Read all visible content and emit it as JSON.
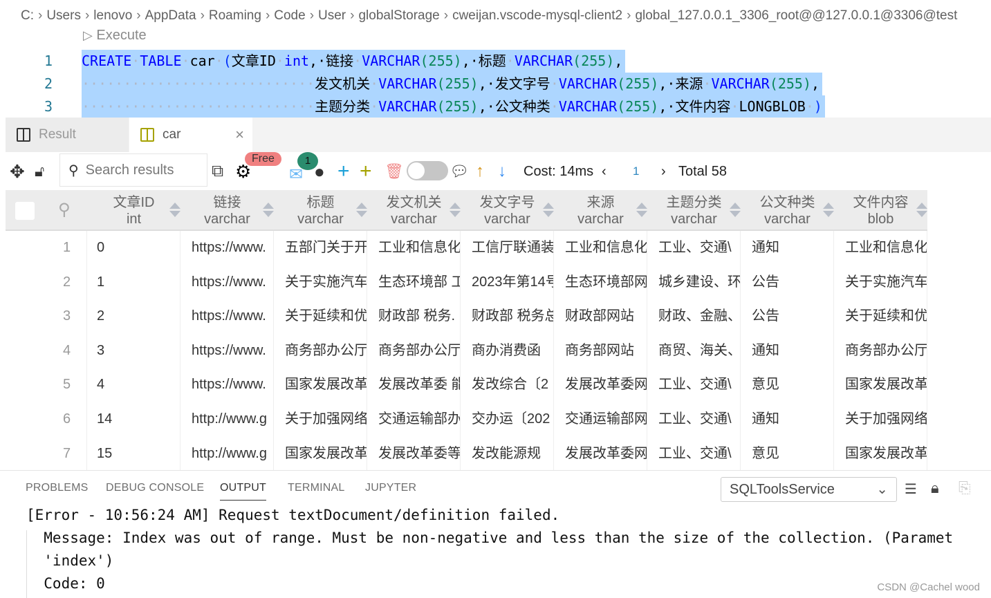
{
  "breadcrumb": [
    "C:",
    "Users",
    "lenovo",
    "AppData",
    "Roaming",
    "Code",
    "User",
    "globalStorage",
    "cweijan.vscode-mysql-client2",
    "global_127.0.0.1_3306_root@@127.0.0.1@3306@test"
  ],
  "editor": {
    "execute_label": "Execute",
    "lines": [
      {
        "num": "1",
        "tokens": [
          [
            "CREATE",
            "kw"
          ],
          [
            "·",
            "ws"
          ],
          [
            "TABLE",
            "kw"
          ],
          [
            "·",
            "ws"
          ],
          [
            "car",
            "tx"
          ],
          [
            "·",
            "ws"
          ],
          [
            "(",
            "br"
          ],
          [
            "文章ID",
            "tx"
          ],
          [
            "·",
            "ws"
          ],
          [
            "int",
            "kw"
          ],
          [
            ",·",
            "tx"
          ],
          [
            "链接",
            "tx"
          ],
          [
            "·",
            "ws"
          ],
          [
            "VARCHAR",
            "kw"
          ],
          [
            "(",
            "num"
          ],
          [
            "255",
            "num"
          ],
          [
            ")",
            "num"
          ],
          [
            ",·",
            "tx"
          ],
          [
            "标题",
            "tx"
          ],
          [
            "·",
            "ws"
          ],
          [
            "VARCHAR",
            "kw"
          ],
          [
            "(",
            "num"
          ],
          [
            "255",
            "num"
          ],
          [
            ")",
            "num"
          ],
          [
            ",",
            "tx"
          ]
        ]
      },
      {
        "num": "2",
        "tokens": [
          [
            "····························",
            "ws"
          ],
          [
            "发文机关",
            "tx"
          ],
          [
            "·",
            "ws"
          ],
          [
            "VARCHAR",
            "kw"
          ],
          [
            "(255)",
            "num"
          ],
          [
            ",·",
            "tx"
          ],
          [
            "发文字号",
            "tx"
          ],
          [
            "·",
            "ws"
          ],
          [
            "VARCHAR",
            "kw"
          ],
          [
            "(255)",
            "num"
          ],
          [
            ",·",
            "tx"
          ],
          [
            "来源",
            "tx"
          ],
          [
            "·",
            "ws"
          ],
          [
            "VARCHAR",
            "kw"
          ],
          [
            "(255)",
            "num"
          ],
          [
            ",",
            "tx"
          ]
        ]
      },
      {
        "num": "3",
        "tokens": [
          [
            "····························",
            "ws"
          ],
          [
            "主题分类",
            "tx"
          ],
          [
            "·",
            "ws"
          ],
          [
            "VARCHAR",
            "kw"
          ],
          [
            "(255)",
            "num"
          ],
          [
            ",·",
            "tx"
          ],
          [
            "公文种类",
            "tx"
          ],
          [
            "·",
            "ws"
          ],
          [
            "VARCHAR",
            "kw"
          ],
          [
            "(255)",
            "num"
          ],
          [
            ",·",
            "tx"
          ],
          [
            "文件内容",
            "tx"
          ],
          [
            "·",
            "ws"
          ],
          [
            "LONGBLOB",
            "tx"
          ],
          [
            "·",
            "ws"
          ],
          [
            ")",
            "br"
          ]
        ]
      }
    ]
  },
  "tabs": [
    {
      "label": "Result",
      "active": false
    },
    {
      "label": "car",
      "active": true
    }
  ],
  "toolbar": {
    "search_placeholder": "Search results",
    "free_badge": "Free",
    "notification_count": "1",
    "cost": "Cost: 14ms",
    "page": "1",
    "total": "Total 58"
  },
  "table": {
    "columns": [
      {
        "name": "文章ID",
        "type": "int"
      },
      {
        "name": "链接",
        "type": "varchar"
      },
      {
        "name": "标题",
        "type": "varchar"
      },
      {
        "name": "发文机关",
        "type": "varchar"
      },
      {
        "name": "发文字号",
        "type": "varchar"
      },
      {
        "name": "来源",
        "type": "varchar"
      },
      {
        "name": "主题分类",
        "type": "varchar"
      },
      {
        "name": "公文种类",
        "type": "varchar"
      },
      {
        "name": "文件内容",
        "type": "blob"
      }
    ],
    "rows": [
      [
        "1",
        "0",
        "https://www.",
        "五部门关于开",
        "工业和信息化",
        "工信厅联通装",
        "工业和信息化",
        "工业、交通\\",
        "通知",
        "工业和信息化"
      ],
      [
        "2",
        "1",
        "https://www.",
        "关于实施汽车",
        "生态环境部 工",
        "2023年第14号",
        "生态环境部网",
        "城乡建设、环",
        "公告",
        "关于实施汽车"
      ],
      [
        "3",
        "2",
        "https://www.",
        "关于延续和优",
        "财政部  税务.",
        "财政部 税务总",
        "财政部网站",
        "财政、金融、",
        "公告",
        "关于延续和优"
      ],
      [
        "4",
        "3",
        "https://www.",
        "商务部办公厅",
        "商务部办公厅",
        "商办消费函",
        "商务部网站",
        "商贸、海关、",
        "通知",
        "商务部办公厅"
      ],
      [
        "5",
        "4",
        "https://www.",
        "国家发展改革",
        "发展改革委 能",
        "发改综合〔2",
        "发展改革委网",
        "工业、交通\\",
        "意见",
        "国家发展改革"
      ],
      [
        "6",
        "14",
        "http://www.g",
        "关于加强网络",
        "交通运输部办",
        "交办运〔202",
        "交通运输部网",
        "工业、交通\\",
        "通知",
        "关于加强网络"
      ],
      [
        "7",
        "15",
        "http://www.g",
        "国家发展改革",
        "发展改革委等",
        "发改能源规",
        "发展改革委网",
        "工业、交通\\",
        "意见",
        "国家发展改革"
      ]
    ]
  },
  "panel": {
    "tabs": [
      "PROBLEMS",
      "DEBUG CONSOLE",
      "OUTPUT",
      "TERMINAL",
      "JUPYTER"
    ],
    "active_tab": "OUTPUT",
    "channel": "SQLToolsService",
    "output": [
      "[Error - 10:56:24 AM] Request textDocument/definition failed.",
      "  Message: Index was out of range. Must be non-negative and less than the size of the collection. (Paramet",
      "  'index')",
      "  Code: 0"
    ]
  },
  "watermark": "CSDN @Cachel wood",
  "colors": {
    "selection": "#add6ff",
    "keyword": "#0000ff",
    "number": "#098658",
    "free_badge": "#f08080",
    "badge": "#2a8c6e"
  }
}
